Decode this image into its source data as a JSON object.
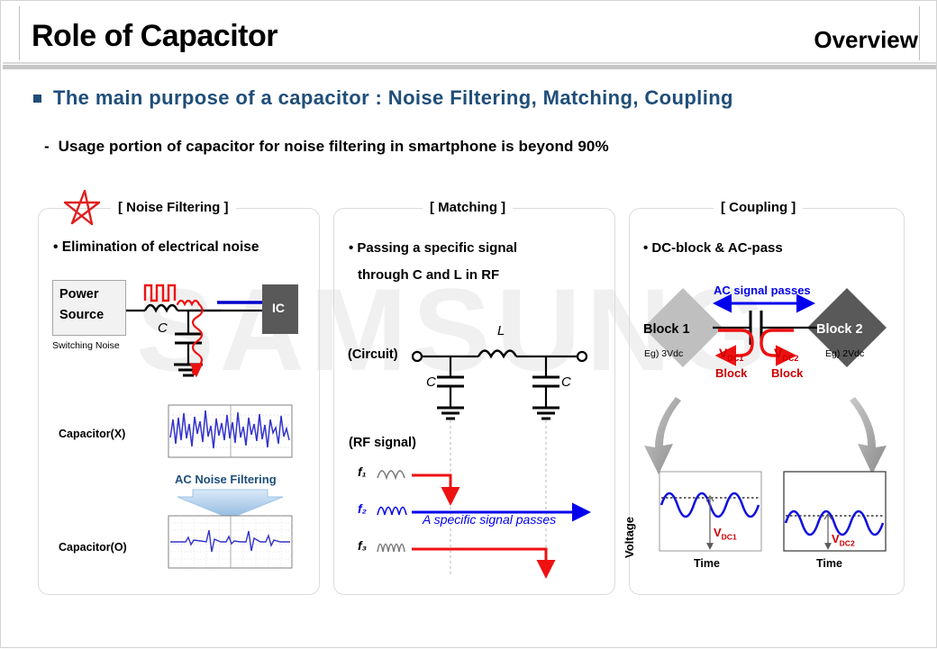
{
  "header": {
    "title": "Role of Capacitor",
    "tag": "Overview"
  },
  "bullets": {
    "main": "The main purpose of a capacitor : Noise Filtering, Matching, Coupling",
    "dash": "-",
    "sub": "Usage portion of capacitor for noise filtering in smartphone is beyond 90%"
  },
  "watermark": "SAMSUNG",
  "panels": {
    "noise": {
      "title": "[ Noise Filtering ]",
      "heading": "• Elimination of electrical noise",
      "power_source_line1": "Power",
      "power_source_line2": "Source",
      "switching_noise": "Switching Noise",
      "ic": "IC",
      "cap_label": "C",
      "wave_top_label": "Capacitor(X)",
      "wave_bottom_label": "Capacitor(O)",
      "arrow_label": "AC Noise Filtering"
    },
    "matching": {
      "title": "[ Matching ]",
      "heading_line1": "• Passing a specific signal",
      "heading_line2": "through C and L in RF",
      "circuit_label": "(Circuit)",
      "inductor_label": "L",
      "cap_left": "C",
      "cap_right": "C",
      "rf_label": "(RF signal)",
      "f1": "f₁",
      "f2": "f₂",
      "f3": "f₃",
      "pass_note": "A specific signal passes"
    },
    "coupling": {
      "title": "[ Coupling ]",
      "heading": "• DC-block & AC-pass",
      "ac_pass": "AC signal passes",
      "block1": "Block 1",
      "block2": "Block 2",
      "eg1": "Eg)  3Vdc",
      "eg2": "Eg)  2Vdc",
      "vdc1": "V",
      "vdc1_sub": "DC1",
      "vdc2": "V",
      "vdc2_sub": "DC2",
      "block_note1": "Block",
      "block_note2": "Block",
      "y_axis": "Voltage",
      "x_axis1": "Time",
      "x_axis2": "Time",
      "graph1_label": "V",
      "graph1_sub": "DC1",
      "graph2_label": "V",
      "graph2_sub": "DC2"
    }
  },
  "colors": {
    "accent_blue": "#1f4e79",
    "signal_blue": "#0000ee",
    "alert_red": "#ee1111",
    "wave_blue": "#2b3fcf",
    "gray_dark": "#595959",
    "gray_light": "#bfbfbf",
    "watermark": "#f0f0f0"
  }
}
